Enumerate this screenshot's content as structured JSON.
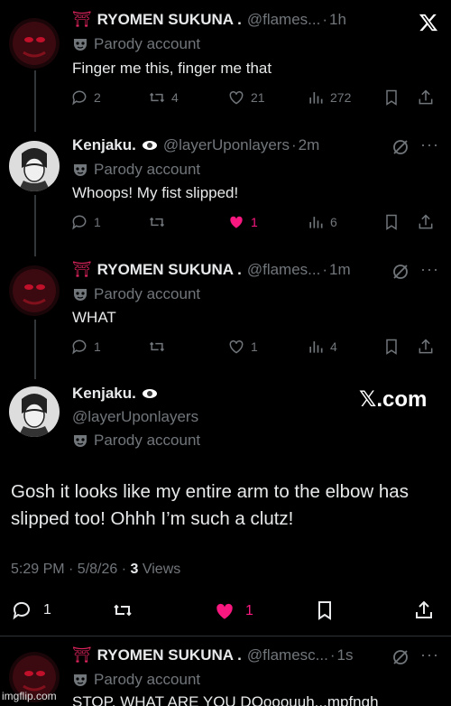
{
  "tweets": [
    {
      "name": "RYOMEN SUKUNA .",
      "handle": "@flames...",
      "sep": "·",
      "time": "1h",
      "parody": "Parody account",
      "text": "Finger me this, finger me that",
      "replies": "2",
      "reposts": "4",
      "likes": "21",
      "views": "272"
    },
    {
      "name": "Kenjaku.",
      "handle": "@layerUponlayers",
      "sep": "·",
      "time": "2m",
      "parody": "Parody account",
      "text": "Whoops! My fist slipped!",
      "replies": "1",
      "reposts": "",
      "likes": "1",
      "views": "6"
    },
    {
      "name": "RYOMEN SUKUNA .",
      "handle": "@flames...",
      "sep": "·",
      "time": "1m",
      "parody": "Parody account",
      "text": "WHAT",
      "replies": "1",
      "reposts": "",
      "likes": "1",
      "views": "4"
    }
  ],
  "main_tweet": {
    "name": "Kenjaku.",
    "handle": "@layerUponlayers",
    "parody": "Parody account",
    "text": "Gosh it looks like my entire arm to the elbow has slipped too! Ohhh I’m such a clutz!",
    "time": "5:29 PM · 5/8/26 · ",
    "views_count": "3",
    "views_label": " Views",
    "replies": "1",
    "likes": "1",
    "watermark_brand": "𝕏.com"
  },
  "reply_tweet": {
    "name": "RYOMEN SUKUNA .",
    "handle": "@flamesc...",
    "sep": "·",
    "time": "1s",
    "parody": "Parody account",
    "text": "STOP, WHAT ARE YOU DOooouuh...mpfngh"
  },
  "footer": {
    "site": "imgflip.com"
  },
  "colors": {
    "like_pink": "#f91880",
    "torii_red": "#e0245e",
    "muted": "#71767b"
  }
}
